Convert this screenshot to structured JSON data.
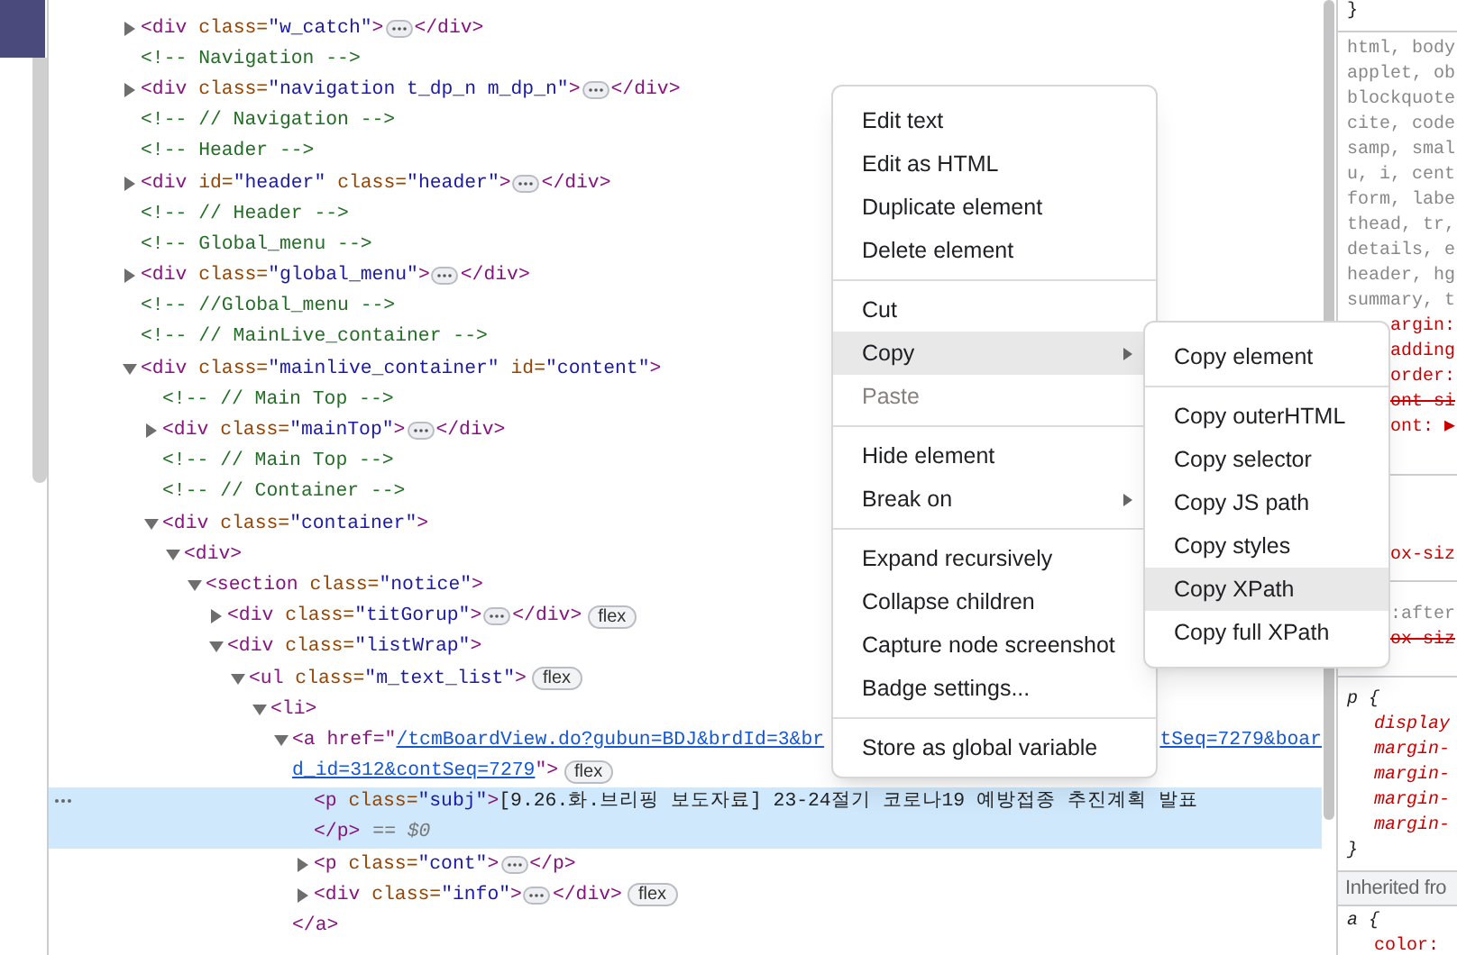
{
  "elements": {
    "nodes": [
      {
        "kind": "element",
        "selected": false,
        "expanded": false,
        "open": "<div class=\"w_catch\">",
        "close": "</div>"
      },
      {
        "kind": "comment",
        "selected": false,
        "text": "<!-- Navigation -->"
      },
      {
        "kind": "element",
        "selected": false,
        "expanded": false,
        "open": "<div class=\"navigation t_dp_n m_dp_n\">",
        "close": "</div>"
      },
      {
        "kind": "comment",
        "selected": false,
        "text": "<!-- // Navigation -->"
      },
      {
        "kind": "comment",
        "selected": false,
        "text": "<!-- Header -->"
      },
      {
        "kind": "element",
        "selected": false,
        "expanded": false,
        "open": "<div id=\"header\" class=\"header\">",
        "close": "</div>"
      },
      {
        "kind": "comment",
        "selected": false,
        "text": "<!-- // Header -->"
      },
      {
        "kind": "comment",
        "selected": false,
        "text": "<!-- Global_menu -->"
      },
      {
        "kind": "element",
        "selected": false,
        "expanded": false,
        "open": "<div class=\"global_menu\">",
        "close": "</div>"
      },
      {
        "kind": "comment",
        "selected": false,
        "text": "<!-- //Global_menu -->"
      },
      {
        "kind": "comment",
        "selected": false,
        "text": "<!-- // MainLive_container -->"
      },
      {
        "kind": "element",
        "selected": false,
        "expanded": true,
        "open": "<div class=\"mainlive_container\" id=\"content\">",
        "children": [
          {
            "kind": "comment",
            "selected": false,
            "text": "<!-- // Main Top -->"
          },
          {
            "kind": "element",
            "selected": false,
            "expanded": false,
            "open": "<div class=\"mainTop\">",
            "close": "</div>"
          },
          {
            "kind": "comment",
            "selected": false,
            "text": "<!-- // Main Top -->"
          },
          {
            "kind": "comment",
            "selected": false,
            "text": "<!-- // Container -->"
          },
          {
            "kind": "element",
            "selected": false,
            "expanded": true,
            "open": "<div class=\"container\">",
            "children": [
              {
                "kind": "element",
                "selected": false,
                "expanded": true,
                "open": "<div>",
                "children": [
                  {
                    "kind": "element",
                    "selected": false,
                    "expanded": true,
                    "open": "<section class=\"notice\">",
                    "children": [
                      {
                        "kind": "element",
                        "selected": false,
                        "expanded": false,
                        "open": "<div class=\"titGorup\">",
                        "close": "</div>",
                        "badge": "flex"
                      },
                      {
                        "kind": "element",
                        "selected": false,
                        "expanded": true,
                        "open": "<div class=\"listWrap\">",
                        "children": [
                          {
                            "kind": "element",
                            "selected": false,
                            "expanded": true,
                            "open": "<ul class=\"m_text_list\">",
                            "badge": "flex",
                            "children": [
                              {
                                "kind": "element",
                                "selected": false,
                                "expanded": true,
                                "open": "<li>",
                                "children": [
                                  {
                                    "kind": "link",
                                    "selected": false,
                                    "expanded": true,
                                    "open": "<a href=\"",
                                    "href_start": "/tcmBoardView.do?gubun=BDJ&brdId=3&br",
                                    "href_end": "tSeq=7279&boar",
                                    "href_line2": "d_id=312&contSeq=7279",
                                    "open_end": "\">",
                                    "badge": "flex",
                                    "close": "</a>",
                                    "children": [
                                      {
                                        "kind": "text_element",
                                        "selected": true,
                                        "open": "<p class=\"subj\">",
                                        "text": "[9.26.화.브리핑 보도자료] 23-24절기 코로나19 예방접종 추진계획 발표",
                                        "close": "</p>",
                                        "suffix": "== $0"
                                      },
                                      {
                                        "kind": "element",
                                        "selected": false,
                                        "expanded": false,
                                        "open": "<p class=\"cont\">",
                                        "close": "</p>"
                                      },
                                      {
                                        "kind": "element",
                                        "selected": false,
                                        "expanded": false,
                                        "open": "<div class=\"info\">",
                                        "close": "</div>",
                                        "badge": "flex"
                                      }
                                    ]
                                  }
                                ]
                              }
                            ]
                          }
                        ]
                      }
                    ]
                  }
                ]
              }
            ]
          }
        ]
      }
    ]
  },
  "styles": {
    "sections": [
      {
        "lines": [
          {
            "kind": "brace",
            "text": "}",
            "covered": false
          }
        ]
      },
      {
        "lines": [
          {
            "kind": "selector",
            "text": "html, body",
            "covered": false
          },
          {
            "kind": "selector",
            "text": "applet, ob",
            "covered": false
          },
          {
            "kind": "selector",
            "text": "blockquote",
            "covered": false
          },
          {
            "kind": "selector",
            "text": "cite, code",
            "covered": false
          },
          {
            "kind": "selector",
            "text": "samp, smal",
            "covered": false
          },
          {
            "kind": "selector",
            "text": "u, i, cent",
            "covered": false
          },
          {
            "kind": "selector",
            "text": "form, labe",
            "covered": false
          },
          {
            "kind": "selector",
            "text": "thead, tr,",
            "covered": false
          },
          {
            "kind": "selector",
            "text": "details, e",
            "covered": false
          },
          {
            "kind": "selector",
            "text": "header, hg",
            "covered": false
          },
          {
            "kind": "selector",
            "text": "summary, t",
            "covered": false
          },
          {
            "kind": "prop",
            "text": "argin:",
            "covered": true
          },
          {
            "kind": "prop",
            "text": "adding",
            "covered": true
          },
          {
            "kind": "prop",
            "text": "order:",
            "covered": true
          },
          {
            "kind": "struck",
            "text": "ont si",
            "covered": true
          },
          {
            "kind": "prop",
            "text": "ont: ▶",
            "covered": true
          }
        ]
      },
      {
        "lines": [
          {
            "kind": "prop",
            "text": "ox-siz",
            "covered": true
          }
        ]
      },
      {
        "lines": [
          {
            "kind": "selector",
            "text": ":after",
            "covered": true
          },
          {
            "kind": "struck",
            "text": "ox-siz",
            "covered": true
          }
        ]
      },
      {
        "lines": [
          {
            "kind": "rule",
            "text": "p {",
            "covered": false
          },
          {
            "kind": "italic",
            "text": "display",
            "covered": false
          },
          {
            "kind": "italic",
            "text": "margin-",
            "covered": false
          },
          {
            "kind": "italic",
            "text": "margin-",
            "covered": false
          },
          {
            "kind": "italic",
            "text": "margin-",
            "covered": false
          },
          {
            "kind": "italic",
            "text": "margin-",
            "covered": false
          },
          {
            "kind": "rule",
            "text": "}",
            "covered": false
          }
        ]
      },
      {
        "lines": [
          {
            "kind": "header",
            "text": "Inherited fro",
            "covered": false
          }
        ]
      },
      {
        "lines": [
          {
            "kind": "rule",
            "text": "a {",
            "covered": false
          },
          {
            "kind": "prop_indent",
            "text": "color:",
            "covered": false
          }
        ]
      }
    ]
  },
  "context_menu": {
    "groups": [
      [
        {
          "label": "Edit text",
          "selected": false,
          "disabled": false,
          "submenu": false
        },
        {
          "label": "Edit as HTML",
          "selected": false,
          "disabled": false,
          "submenu": false
        },
        {
          "label": "Duplicate element",
          "selected": false,
          "disabled": false,
          "submenu": false
        },
        {
          "label": "Delete element",
          "selected": false,
          "disabled": false,
          "submenu": false
        }
      ],
      [
        {
          "label": "Cut",
          "selected": false,
          "disabled": false,
          "submenu": false
        },
        {
          "label": "Copy",
          "selected": true,
          "disabled": false,
          "submenu": true
        },
        {
          "label": "Paste",
          "selected": false,
          "disabled": true,
          "submenu": false
        }
      ],
      [
        {
          "label": "Hide element",
          "selected": false,
          "disabled": false,
          "submenu": false
        },
        {
          "label": "Break on",
          "selected": false,
          "disabled": false,
          "submenu": true
        }
      ],
      [
        {
          "label": "Expand recursively",
          "selected": false,
          "disabled": false,
          "submenu": false
        },
        {
          "label": "Collapse children",
          "selected": false,
          "disabled": false,
          "submenu": false
        },
        {
          "label": "Capture node screenshot",
          "selected": false,
          "disabled": false,
          "submenu": false
        },
        {
          "label": "Badge settings...",
          "selected": false,
          "disabled": false,
          "submenu": false
        }
      ],
      [
        {
          "label": "Store as global variable",
          "selected": false,
          "disabled": false,
          "submenu": false
        }
      ]
    ]
  },
  "submenu": {
    "groups": [
      [
        {
          "label": "Copy element",
          "selected": false
        }
      ],
      [
        {
          "label": "Copy outerHTML",
          "selected": false
        },
        {
          "label": "Copy selector",
          "selected": false
        },
        {
          "label": "Copy JS path",
          "selected": false
        },
        {
          "label": "Copy styles",
          "selected": false
        },
        {
          "label": "Copy XPath",
          "selected": true
        },
        {
          "label": "Copy full XPath",
          "selected": false
        }
      ]
    ]
  }
}
